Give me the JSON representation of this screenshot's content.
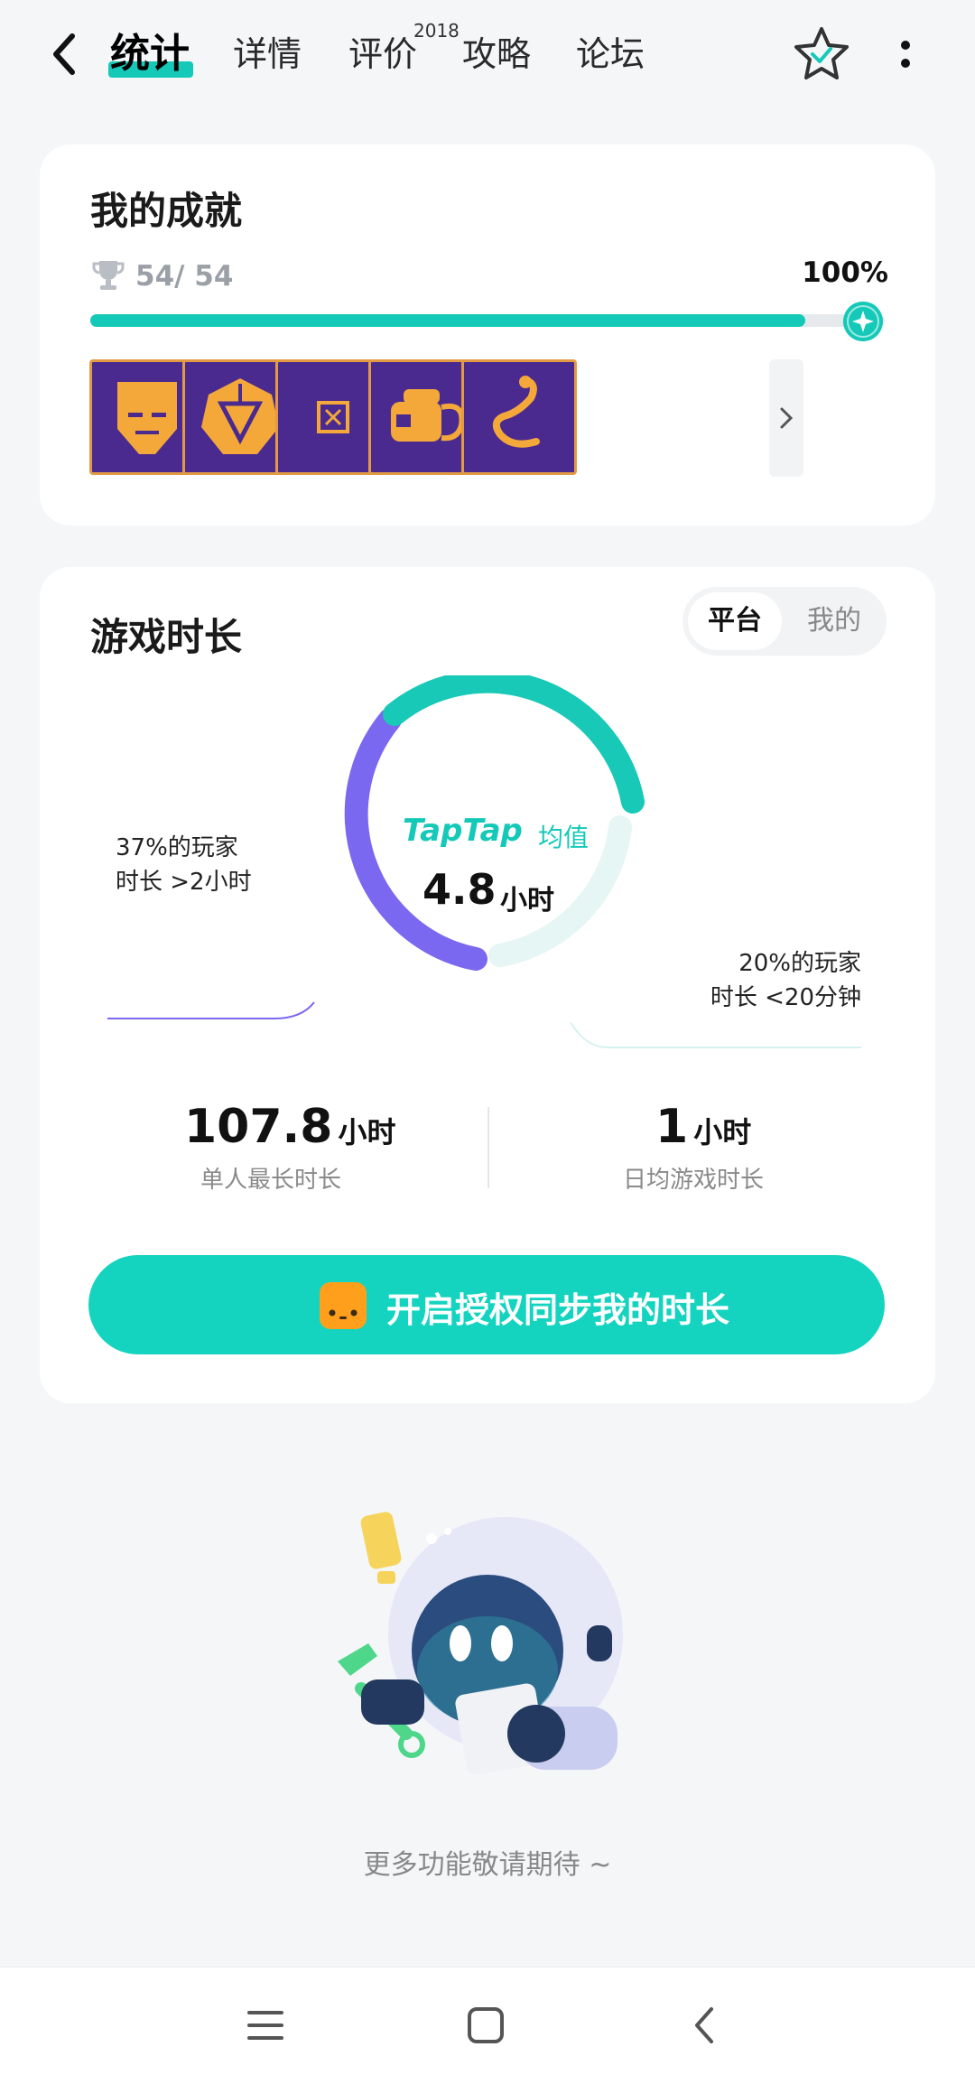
{
  "header": {
    "tabs": [
      {
        "label": "统计",
        "active": true
      },
      {
        "label": "详情"
      },
      {
        "label": "评价"
      },
      {
        "label": "攻略"
      },
      {
        "label": "论坛"
      }
    ],
    "review_badge": "2018",
    "icons": {
      "back": "chevron-left-icon",
      "favorite": "star-check-icon",
      "more": "more-vertical-icon"
    }
  },
  "achievements": {
    "title": "我的成就",
    "count_text": "54/ 54",
    "percent_text": "100%",
    "progress": 1.0,
    "badge_icons": [
      "mask-icon",
      "rune-icon",
      "box-icon",
      "teapot-icon",
      "snake-icon"
    ],
    "colors": {
      "accent": "#14c9b8",
      "tile": "#4a2a8e",
      "tile_border": "#e39a45"
    }
  },
  "playtime": {
    "title": "游戏时长",
    "toggle": {
      "on": "平台",
      "off": "我的"
    },
    "center_brand": "TapTap",
    "center_label": "均值",
    "center_value": "4.8",
    "center_unit": "小时",
    "left_note": [
      "37%的玩家",
      "时长 >2小时"
    ],
    "right_note": [
      "20%的玩家",
      "时长 <20分钟"
    ],
    "stats": [
      {
        "value": "107.8",
        "unit": "小时",
        "label": "单人最长时长"
      },
      {
        "value": "1",
        "unit": "小时",
        "label": "日均游戏时长"
      }
    ],
    "sync_button": "开启授权同步我的时长",
    "colors": {
      "purple": "#7a68f0",
      "teal": "#17c9b6",
      "light": "#e5f6f5"
    }
  },
  "footer": {
    "coming_soon": "更多功能敬请期待 ~"
  },
  "navbar": {
    "icons": [
      "menu-icon",
      "home-icon",
      "back-icon"
    ]
  }
}
